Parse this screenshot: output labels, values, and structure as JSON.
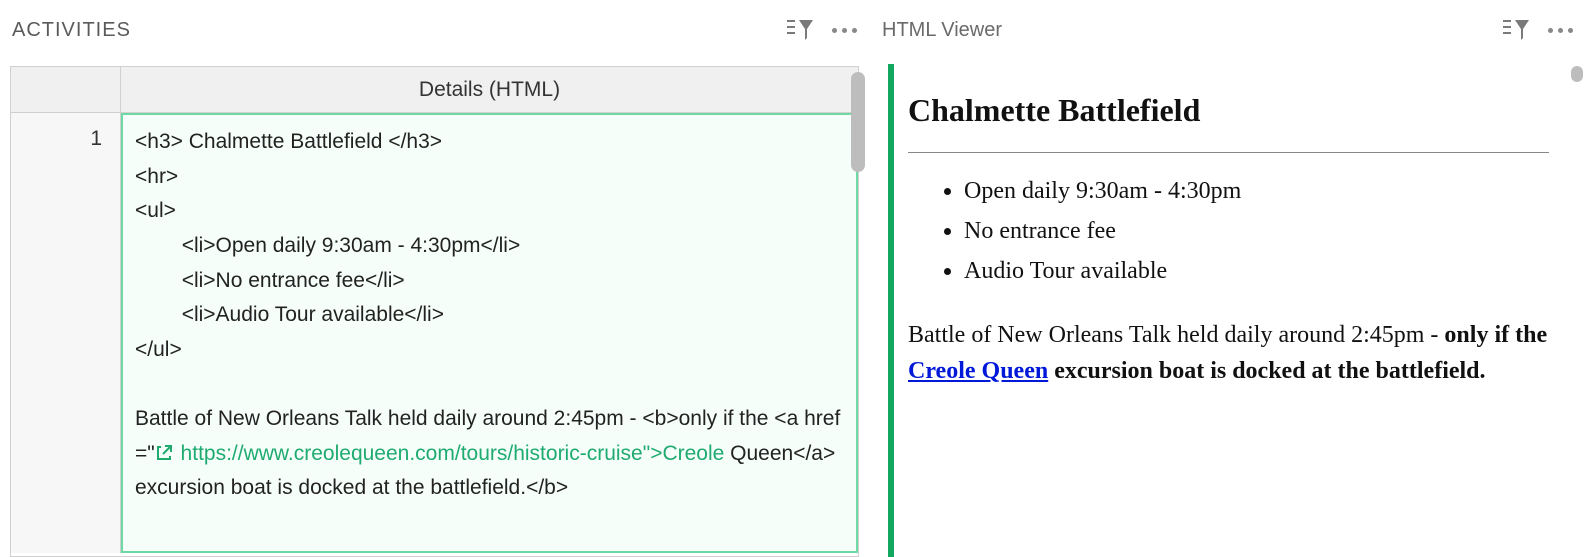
{
  "left_panel": {
    "title": "ACTIVITIES",
    "column_header": "Details (HTML)",
    "rows": [
      {
        "num": "1",
        "seg1": "<h3> Chalmette Battlefield </h3>\n<hr>\n<ul>\n        <li>Open daily 9:30am - 4:30pm</li>\n        <li>No entrance fee</li>\n        <li>Audio Tour available</li>\n</ul>\n\nBattle of New Orleans Talk held daily around 2:45pm - <b>only if the <a href=\"",
        "link_text": " https://www.creolequeen.com/tours/historic-cruise\">Creole",
        "seg2": " Queen</a> excursion boat is docked at the battlefield.</b>"
      }
    ]
  },
  "right_panel": {
    "title": "HTML Viewer",
    "heading": "Chalmette Battlefield",
    "list": [
      "Open daily 9:30am - 4:30pm",
      "No entrance fee",
      "Audio Tour available"
    ],
    "para_before": "Battle of New Orleans Talk held daily around 2:45pm - ",
    "bold_before_link": "only if the ",
    "link_text": "Creole Queen",
    "bold_after_link": " excursion boat is docked at the battlefield."
  }
}
